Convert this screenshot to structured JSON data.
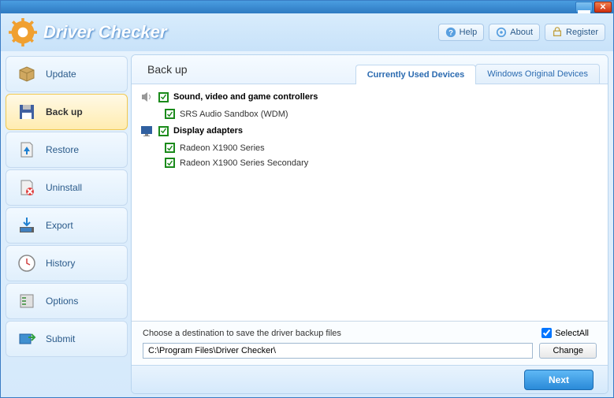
{
  "app_title": "Driver Checker",
  "header_buttons": {
    "help": "Help",
    "about": "About",
    "register": "Register"
  },
  "sidebar": {
    "update": "Update",
    "backup": "Back up",
    "restore": "Restore",
    "uninstall": "Uninstall",
    "export": "Export",
    "history": "History",
    "options": "Options",
    "submit": "Submit"
  },
  "page": {
    "title": "Back up",
    "tabs": {
      "current": "Currently Used Devices",
      "original": "Windows Original Devices"
    }
  },
  "categories": [
    {
      "name": "Sound, video and game controllers",
      "checked": true,
      "icon": "speaker",
      "devices": [
        {
          "name": "SRS Audio Sandbox (WDM)",
          "checked": true
        }
      ]
    },
    {
      "name": "Display adapters",
      "checked": true,
      "icon": "monitor",
      "devices": [
        {
          "name": "Radeon X1900 Series",
          "checked": true
        },
        {
          "name": "Radeon X1900 Series Secondary",
          "checked": true
        }
      ]
    }
  ],
  "destination": {
    "label": "Choose a destination to save the driver backup files",
    "path": "C:\\Program Files\\Driver Checker\\",
    "select_all": "SelectAll",
    "select_all_checked": true,
    "change": "Change"
  },
  "footer": {
    "next": "Next"
  }
}
